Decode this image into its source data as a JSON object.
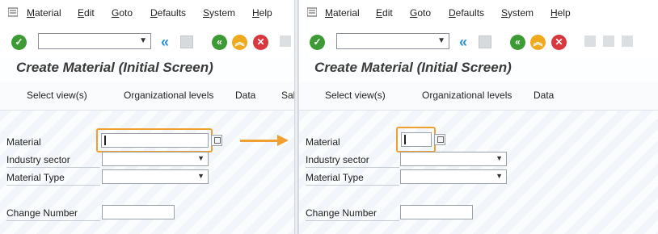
{
  "menu": [
    "Material",
    "Edit",
    "Goto",
    "Defaults",
    "System",
    "Help"
  ],
  "menu_underlined": [
    "M",
    "E",
    "G",
    "D",
    "S",
    "H"
  ],
  "title": "Create Material (Initial Screen)",
  "app_toolbar": {
    "left": [
      "Select view(s)",
      "Organizational levels",
      "Data",
      "Sale"
    ],
    "right": [
      "Select view(s)",
      "Organizational levels",
      "Data"
    ]
  },
  "fields": {
    "material_label": "Material",
    "industry_label": "Industry sector",
    "type_label": "Material Type",
    "change_label": "Change Number",
    "material_value": "",
    "industry_value": "",
    "type_value": "",
    "change_value": ""
  },
  "colors": {
    "highlight": "#f0a030",
    "check_green": "#3d9b35",
    "back_blue": "#2a8fd6",
    "exit_orange": "#f0a81c",
    "cancel_red": "#d9363e"
  }
}
